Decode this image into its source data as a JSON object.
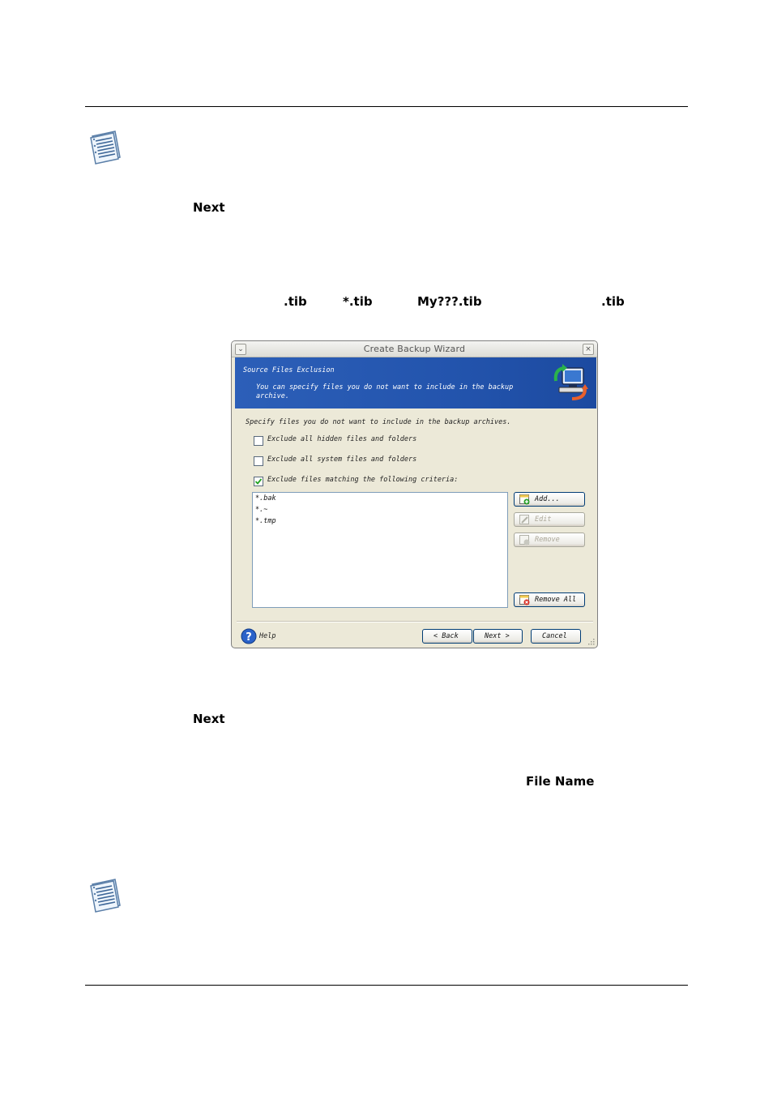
{
  "page": {
    "text_next_1": "Next",
    "text_tib": ".tib",
    "text_star_tib": "*.tib",
    "text_my_tib": "My???.tib",
    "text_tib_2": ".tib",
    "text_next_2": "Next",
    "text_file_name": "File Name"
  },
  "dialog": {
    "title": "Create Backup Wizard",
    "banner_title": "Source Files Exclusion",
    "banner_desc": "You can specify files you do not want to include in the backup archive.",
    "instruction": "Specify files you do not want to include in the backup archives.",
    "checkboxes": [
      {
        "label": "Exclude all hidden files and folders",
        "checked": false
      },
      {
        "label": "Exclude all system files and folders",
        "checked": false
      },
      {
        "label": "Exclude files matching the following criteria:",
        "checked": true
      }
    ],
    "criteria": [
      "*.bak",
      "*.~",
      "*.tmp"
    ],
    "buttons": {
      "add": "Add...",
      "edit": "Edit",
      "remove": "Remove",
      "remove_all": "Remove All",
      "help": "Help",
      "back": "< Back",
      "next": "Next >",
      "cancel": "Cancel"
    }
  }
}
